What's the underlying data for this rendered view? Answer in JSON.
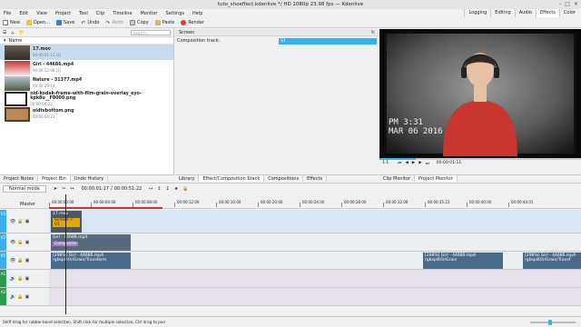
{
  "window": {
    "title": "tuto_shoeffect.kdenlive */ HD 1080p 23.98 fps — Kdenlive"
  },
  "menu": [
    "File",
    "Edit",
    "View",
    "Project",
    "Tool",
    "Clip",
    "Timeline",
    "Monitor",
    "Settings",
    "Help"
  ],
  "layouts": [
    "Logging",
    "Editing",
    "Audio",
    "Effects",
    "Color"
  ],
  "toolbar": {
    "new": "New",
    "open": "Open...",
    "save": "Save",
    "undo": "Undo",
    "redo": "Redo",
    "copy": "Copy",
    "paste": "Paste",
    "render": "Render"
  },
  "bin": {
    "search_placeholder": "Search...",
    "column": "Name",
    "items": [
      {
        "name": "17.mov",
        "duration": "00:00:01:11 [1]"
      },
      {
        "name": "Girl - 44686.mp4",
        "duration": "00:00:22:08 [1]"
      },
      {
        "name": "Nature - 31377.mp4",
        "duration": "00:00:29:14"
      },
      {
        "name": "old-kodak-frame-with-film-grain-overlay_eyo-kpk8u__F0000.png",
        "duration": "00:00:04:23"
      },
      {
        "name": "oldtvbottom.png",
        "duration": "00:00:04:23"
      }
    ]
  },
  "tabs_left": [
    "Project Notes",
    "Project Bin",
    "Undo History"
  ],
  "tabs_mid": [
    "Library",
    "Effect/Composition Stack",
    "Compositions",
    "Effects"
  ],
  "tabs_right": [
    "Clip Monitor",
    "Project Monitor"
  ],
  "effect_stack": {
    "title": "Screen",
    "composition_label": "Composition track:",
    "composition_value": "V1"
  },
  "monitor": {
    "overlay_time": "PM 3:31",
    "overlay_date": "MAR 06 2016",
    "zoom": "1:1",
    "timecode": "00:00:01:11"
  },
  "timeline": {
    "mode": "Normal mode",
    "position": "00:00:01:17",
    "duration": "00:00:51:22",
    "master": "Master",
    "ruler": [
      "00:00:00:00",
      "00:00:04:00",
      "00:00:08:00",
      "00:00:12:00",
      "00:00:16:00",
      "00:00:20:00",
      "00:00:24:00",
      "00:00:28:00",
      "00:00:32:00",
      "00:00:35:23",
      "00:00:40:00",
      "00:00:44:01"
    ],
    "tracks": [
      {
        "label": "V3",
        "clips": [
          {
            "title": "17.mov",
            "sub": "Screen > V1"
          }
        ]
      },
      {
        "label": "V2",
        "clips": [
          {
            "title": "Girl - 44686.mp4",
            "sub": "Composite"
          }
        ]
      },
      {
        "label": "V1",
        "clips": [
          {
            "title": "[298%] Girl - 44686.mp4",
            "sub": "rgbsplit0r/Grain/Transform"
          },
          {
            "title": "[298%] Girl - 44686.mp4",
            "sub": "rgbsplit0r/Grain"
          },
          {
            "title": "[298%] Girl - 44686.mp4",
            "sub": "rgbsplit0r/Grain/Transf"
          }
        ]
      },
      {
        "label": "A1",
        "clips": []
      },
      {
        "label": "A2",
        "clips": []
      }
    ]
  },
  "status": "Shift drag for rubber-band selection, Shift click for multiple selection, Ctrl drag to pan",
  "colors": {
    "accent": "#3daee9",
    "video_clip": "#4a6a8a",
    "audio_track": "#2d9b4f",
    "selected": "#c5dbf1"
  }
}
